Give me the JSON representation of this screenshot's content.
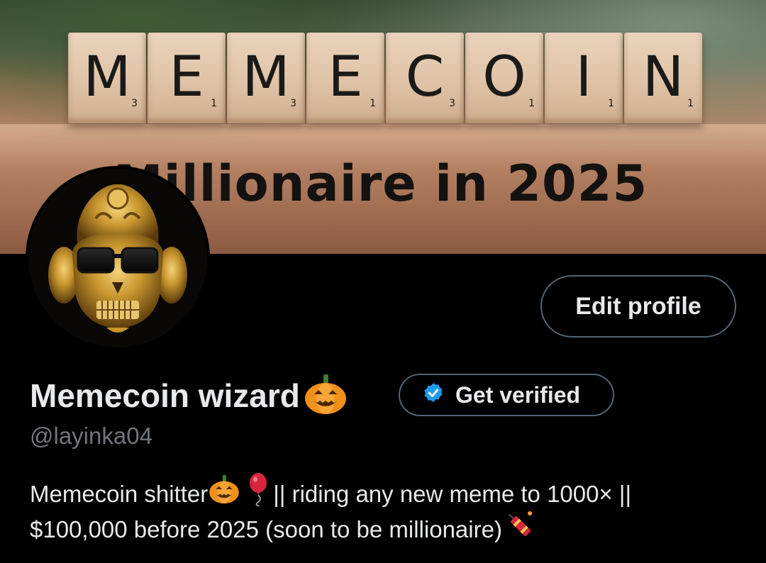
{
  "banner": {
    "tiles": [
      {
        "letter": "M",
        "points": "3"
      },
      {
        "letter": "E",
        "points": "1"
      },
      {
        "letter": "M",
        "points": "3"
      },
      {
        "letter": "E",
        "points": "1"
      },
      {
        "letter": "C",
        "points": "3"
      },
      {
        "letter": "O",
        "points": "1"
      },
      {
        "letter": "I",
        "points": "1"
      },
      {
        "letter": "N",
        "points": "1"
      }
    ],
    "caption": "Millionaire in 2025"
  },
  "profile": {
    "display_name": "Memecoin wizard",
    "name_emoji": "pumpkin-icon",
    "handle": "@layinka04",
    "edit_label": "Edit profile",
    "verify_label": "Get verified",
    "verify_color": "#1d9bf0"
  },
  "bio": {
    "line1_a": "Memecoin shitter",
    "line1_b": "|| riding any new meme to 1000× ||",
    "line2": "$100,000 before 2025 (soon to be millionaire)",
    "emojis": [
      "pumpkin-icon",
      "balloon-icon",
      "firecracker-icon"
    ]
  },
  "colors": {
    "background": "#000000",
    "text": "#e7e9ea",
    "muted": "#71767b",
    "border": "#536471",
    "verified_blue": "#1d9bf0"
  }
}
